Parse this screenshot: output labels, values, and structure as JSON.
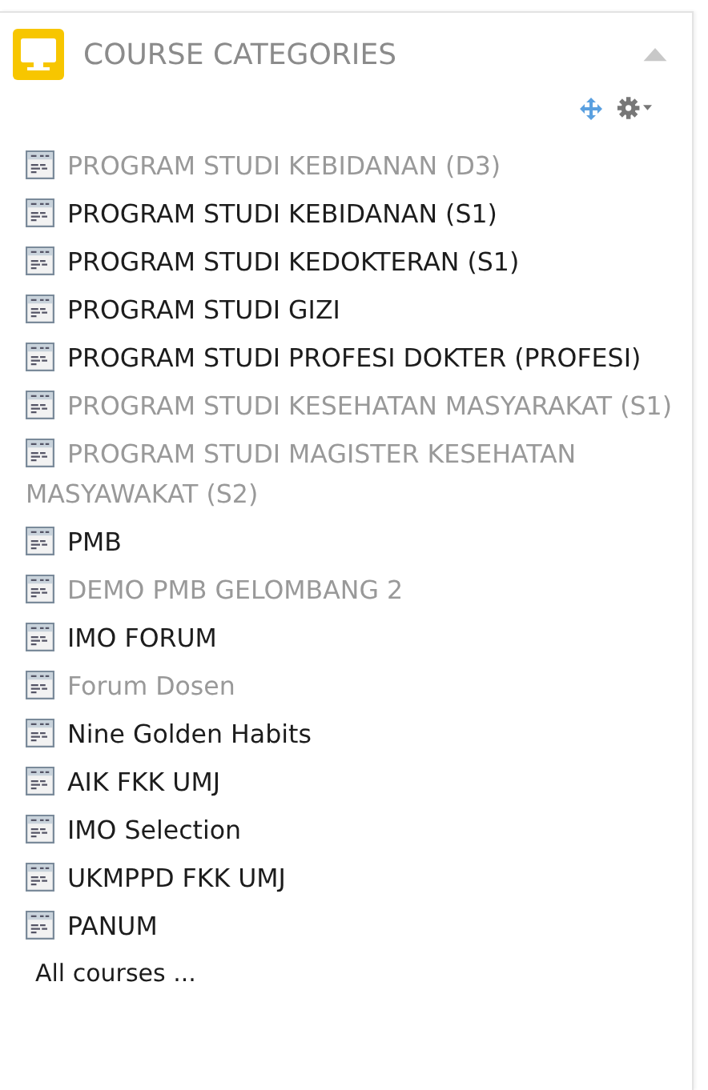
{
  "block": {
    "title": "COURSE CATEGORIES",
    "collapsed": false
  },
  "categories": [
    {
      "name": "PROGRAM STUDI KEBIDANAN (D3)",
      "dimmed": true
    },
    {
      "name": "PROGRAM STUDI KEBIDANAN (S1)",
      "dimmed": false
    },
    {
      "name": "PROGRAM STUDI KEDOKTERAN (S1)",
      "dimmed": false
    },
    {
      "name": "PROGRAM STUDI GIZI",
      "dimmed": false
    },
    {
      "name": "PROGRAM STUDI PROFESI DOKTER (PROFESI)",
      "dimmed": false
    },
    {
      "name": "PROGRAM STUDI KESEHATAN MASYARAKAT (S1)",
      "dimmed": true
    },
    {
      "name": "PROGRAM STUDI MAGISTER KESEHATAN MASYAWAKAT (S2)",
      "dimmed": true
    },
    {
      "name": "PMB",
      "dimmed": false
    },
    {
      "name": "DEMO PMB GELOMBANG 2",
      "dimmed": true
    },
    {
      "name": "IMO FORUM",
      "dimmed": false
    },
    {
      "name": "Forum Dosen",
      "dimmed": true
    },
    {
      "name": "Nine Golden Habits",
      "dimmed": false
    },
    {
      "name": "AIK FKK UMJ",
      "dimmed": false
    },
    {
      "name": "IMO Selection",
      "dimmed": false
    },
    {
      "name": "UKMPPD FKK UMJ",
      "dimmed": false
    },
    {
      "name": "PANUM",
      "dimmed": false
    }
  ],
  "footer_link": "All courses ..."
}
